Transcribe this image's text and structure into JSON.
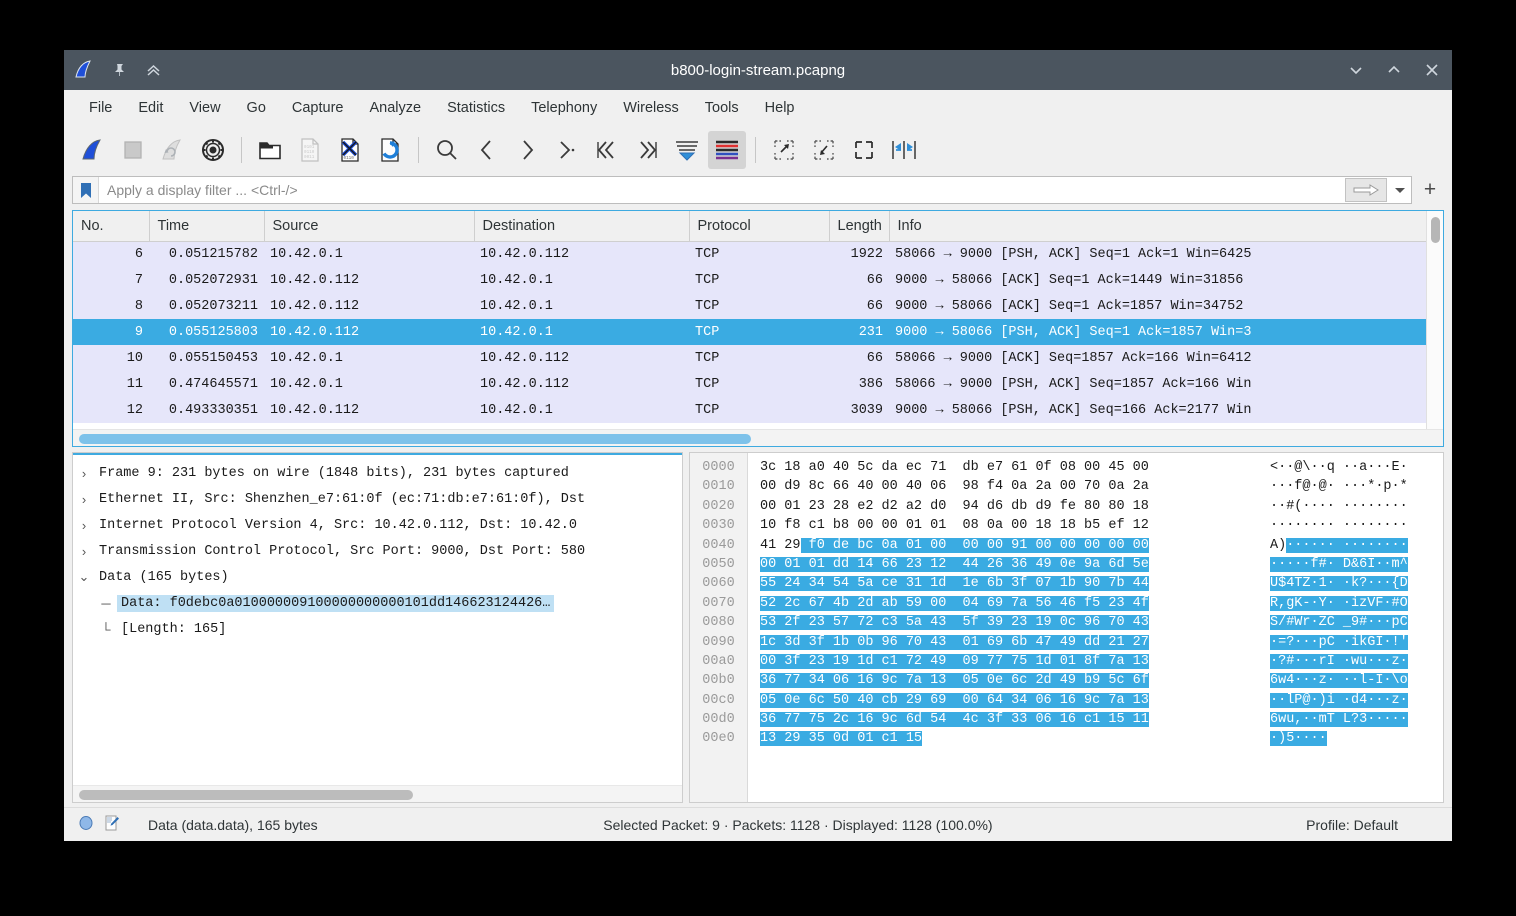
{
  "window": {
    "title": "b800-login-stream.pcapng",
    "icon": "wireshark-fin-icon",
    "pin_icon": "pin-icon",
    "collapse_icon": "chevrons-up-icon",
    "minimize_label": "⌄",
    "maximize_label": "⌃",
    "close_label": "✕"
  },
  "menubar": {
    "items": [
      {
        "label": "File"
      },
      {
        "label": "Edit"
      },
      {
        "label": "View"
      },
      {
        "label": "Go"
      },
      {
        "label": "Capture"
      },
      {
        "label": "Analyze"
      },
      {
        "label": "Statistics"
      },
      {
        "label": "Telephony"
      },
      {
        "label": "Wireless"
      },
      {
        "label": "Tools"
      },
      {
        "label": "Help"
      }
    ]
  },
  "toolbar": {
    "items": [
      {
        "name": "start-capture-icon",
        "title": "Start capturing packets",
        "disabled": false
      },
      {
        "name": "stop-capture-icon",
        "title": "Stop capturing packets",
        "disabled": true
      },
      {
        "name": "restart-capture-icon",
        "title": "Restart current capture",
        "disabled": true
      },
      {
        "name": "capture-options-icon",
        "title": "Capture options",
        "disabled": false
      },
      {
        "sep": true
      },
      {
        "name": "open-file-icon",
        "title": "Open a capture file",
        "disabled": false
      },
      {
        "name": "save-file-icon",
        "title": "Save this capture file",
        "disabled": true
      },
      {
        "name": "close-file-icon",
        "title": "Close this capture file",
        "disabled": false
      },
      {
        "name": "reload-file-icon",
        "title": "Reload this file",
        "disabled": false
      },
      {
        "sep": true
      },
      {
        "name": "find-packet-icon",
        "title": "Find a packet",
        "disabled": false
      },
      {
        "name": "go-back-icon",
        "title": "Go back in packet history",
        "disabled": false
      },
      {
        "name": "go-forward-icon",
        "title": "Go forward in packet history",
        "disabled": false
      },
      {
        "name": "go-to-packet-icon",
        "title": "Go to the packet with number",
        "disabled": false
      },
      {
        "name": "go-first-packet-icon",
        "title": "Go to the first packet",
        "disabled": false
      },
      {
        "name": "go-last-packet-icon",
        "title": "Go to the last packet",
        "disabled": false
      },
      {
        "name": "auto-scroll-icon",
        "title": "Auto scroll in live capture",
        "disabled": false
      },
      {
        "name": "colorize-packets-icon",
        "title": "Colorize packet list",
        "disabled": false,
        "active": true
      },
      {
        "sep": true
      },
      {
        "name": "zoom-in-icon",
        "title": "Zoom in",
        "disabled": false
      },
      {
        "name": "zoom-out-icon",
        "title": "Zoom out",
        "disabled": false
      },
      {
        "name": "zoom-reset-icon",
        "title": "Normal size",
        "disabled": false
      },
      {
        "name": "resize-columns-icon",
        "title": "Resize columns",
        "disabled": false
      }
    ]
  },
  "filter": {
    "bookmark_icon": "bookmark-icon",
    "placeholder": "Apply a display filter ... <Ctrl-/>",
    "value": "",
    "apply_icon": "arrow-right-icon",
    "caret_icon": "chevron-down-icon",
    "add_label": "+"
  },
  "packet_list": {
    "columns": [
      "No.",
      "Time",
      "Source",
      "Destination",
      "Protocol",
      "Length",
      "Info"
    ],
    "rows": [
      {
        "no": "6",
        "time": "0.051215782",
        "src": "10.42.0.1",
        "dst": "10.42.0.112",
        "proto": "TCP",
        "len": "1922",
        "info": "58066 → 9000 [PSH, ACK] Seq=1 Ack=1 Win=6425",
        "selected": false
      },
      {
        "no": "7",
        "time": "0.052072931",
        "src": "10.42.0.112",
        "dst": "10.42.0.1",
        "proto": "TCP",
        "len": "66",
        "info": "9000 → 58066 [ACK] Seq=1 Ack=1449 Win=31856",
        "selected": false
      },
      {
        "no": "8",
        "time": "0.052073211",
        "src": "10.42.0.112",
        "dst": "10.42.0.1",
        "proto": "TCP",
        "len": "66",
        "info": "9000 → 58066 [ACK] Seq=1 Ack=1857 Win=34752",
        "selected": false
      },
      {
        "no": "9",
        "time": "0.055125803",
        "src": "10.42.0.112",
        "dst": "10.42.0.1",
        "proto": "TCP",
        "len": "231",
        "info": "9000 → 58066 [PSH, ACK] Seq=1 Ack=1857 Win=3",
        "selected": true
      },
      {
        "no": "10",
        "time": "0.055150453",
        "src": "10.42.0.1",
        "dst": "10.42.0.112",
        "proto": "TCP",
        "len": "66",
        "info": "58066 → 9000 [ACK] Seq=1857 Ack=166 Win=6412",
        "selected": false
      },
      {
        "no": "11",
        "time": "0.474645571",
        "src": "10.42.0.1",
        "dst": "10.42.0.112",
        "proto": "TCP",
        "len": "386",
        "info": "58066 → 9000 [PSH, ACK] Seq=1857 Ack=166 Win",
        "selected": false
      },
      {
        "no": "12",
        "time": "0.493330351",
        "src": "10.42.0.112",
        "dst": "10.42.0.1",
        "proto": "TCP",
        "len": "3039",
        "info": "9000 → 58066 [PSH, ACK] Seq=166 Ack=2177 Win",
        "selected": false
      }
    ]
  },
  "packet_detail": {
    "rows": [
      {
        "twisty": "›",
        "text": "Frame 9: 231 bytes on wire (1848 bits), 231 bytes captured",
        "level": 0,
        "selected": false
      },
      {
        "twisty": "›",
        "text": "Ethernet II, Src: Shenzhen_e7:61:0f (ec:71:db:e7:61:0f), Dst",
        "level": 0,
        "selected": false
      },
      {
        "twisty": "›",
        "text": "Internet Protocol Version 4, Src: 10.42.0.112, Dst: 10.42.0",
        "level": 0,
        "selected": false
      },
      {
        "twisty": "›",
        "text": "Transmission Control Protocol, Src Port: 9000, Dst Port: 580",
        "level": 0,
        "selected": false
      },
      {
        "twisty": "⌄",
        "text": "Data (165 bytes)",
        "level": 0,
        "selected": false
      },
      {
        "twisty": "─",
        "text": "Data: f0debc0a010000009100000000000101dd146623124426…",
        "level": 1,
        "selected": true
      },
      {
        "twisty": "└",
        "text": "[Length: 165]",
        "level": 1,
        "selected": false
      }
    ]
  },
  "hex_dump": {
    "highlight_start": 66,
    "highlight_end": 231,
    "lines": [
      {
        "offset": "0000",
        "bytes": "3c 18 a0 40 5c da ec 71  db e7 61 0f 08 00 45 00",
        "ascii": "<··@\\··q ··a···E·"
      },
      {
        "offset": "0010",
        "bytes": "00 d9 8c 66 40 00 40 06  98 f4 0a 2a 00 70 0a 2a",
        "ascii": "···f@·@· ···*·p·*"
      },
      {
        "offset": "0020",
        "bytes": "00 01 23 28 e2 d2 a2 d0  94 d6 db d9 fe 80 80 18",
        "ascii": "··#(···· ········"
      },
      {
        "offset": "0030",
        "bytes": "10 f8 c1 b8 00 00 01 01  08 0a 00 18 18 b5 ef 12",
        "ascii": "········ ········"
      },
      {
        "offset": "0040",
        "bytes": "41 29 f0 de bc 0a 01 00  00 00 91 00 00 00 00 00",
        "ascii": "A)······ ········"
      },
      {
        "offset": "0050",
        "bytes": "00 01 01 dd 14 66 23 12  44 26 36 49 0e 9a 6d 5e",
        "ascii": "·····f#· D&6I··m^"
      },
      {
        "offset": "0060",
        "bytes": "55 24 34 54 5a ce 31 1d  1e 6b 3f 07 1b 90 7b 44",
        "ascii": "U$4TZ·1· ·k?···{D"
      },
      {
        "offset": "0070",
        "bytes": "52 2c 67 4b 2d ab 59 00  04 69 7a 56 46 f5 23 4f",
        "ascii": "R,gK-·Y· ·izVF·#O"
      },
      {
        "offset": "0080",
        "bytes": "53 2f 23 57 72 c3 5a 43  5f 39 23 19 0c 96 70 43",
        "ascii": "S/#Wr·ZC _9#···pC"
      },
      {
        "offset": "0090",
        "bytes": "1c 3d 3f 1b 0b 96 70 43  01 69 6b 47 49 dd 21 27",
        "ascii": "·=?···pC ·ikGI·!'"
      },
      {
        "offset": "00a0",
        "bytes": "00 3f 23 19 1d c1 72 49  09 77 75 1d 01 8f 7a 13",
        "ascii": "·?#···rI ·wu···z·"
      },
      {
        "offset": "00b0",
        "bytes": "36 77 34 06 16 9c 7a 13  05 0e 6c 2d 49 b9 5c 6f",
        "ascii": "6w4···z· ··l-I·\\o"
      },
      {
        "offset": "00c0",
        "bytes": "05 0e 6c 50 40 cb 29 69  00 64 34 06 16 9c 7a 13",
        "ascii": "··lP@·)i ·d4···z·"
      },
      {
        "offset": "00d0",
        "bytes": "36 77 75 2c 16 9c 6d 54  4c 3f 33 06 16 c1 15 11",
        "ascii": "6wu,··mT L?3·····"
      },
      {
        "offset": "00e0",
        "bytes": "13 29 35 0d 01 c1 15",
        "ascii": "·)5····"
      }
    ]
  },
  "statusbar": {
    "expert_icon": "expert-info-circle-icon",
    "comment_icon": "capture-comment-icon",
    "field_text": "Data (data.data), 165 bytes",
    "center_text": "Selected Packet: 9 · Packets: 1128 · Displayed: 1128 (100.0%)",
    "profile_text": "Profile: Default"
  },
  "colors": {
    "titlebar": "#4b555f",
    "selection": "#3aabe2",
    "row_bg": "#e6e6fa",
    "accent": "#1f6fb5",
    "chrome": "#f0f0f0"
  }
}
